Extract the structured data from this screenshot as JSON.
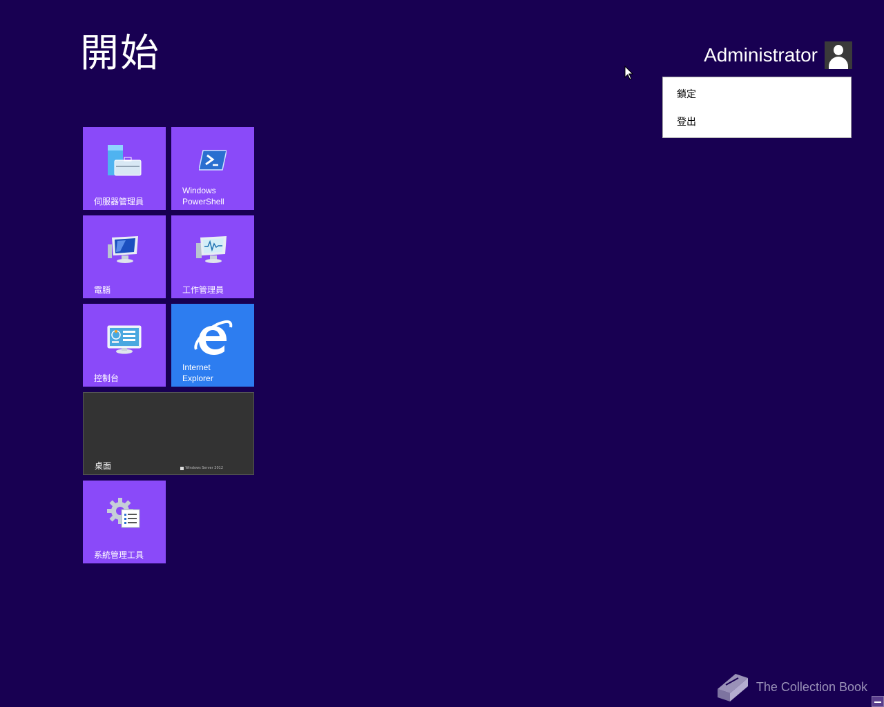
{
  "start": {
    "title": "開始"
  },
  "user": {
    "name": "Administrator",
    "menu": [
      {
        "label": "鎖定"
      },
      {
        "label": "登出"
      }
    ]
  },
  "tiles": {
    "server_manager": {
      "label": "伺服器管理員"
    },
    "powershell": {
      "label": "Windows\nPowerShell"
    },
    "computer": {
      "label": "電腦"
    },
    "task_manager": {
      "label": "工作管理員"
    },
    "control_panel": {
      "label": "控制台"
    },
    "internet_explorer": {
      "label": "Internet\nExplorer"
    },
    "desktop": {
      "label": "桌面",
      "brand": "Windows Server 2012"
    },
    "admin_tools": {
      "label": "系統管理工具"
    }
  },
  "watermark": {
    "text": "The Collection Book"
  },
  "colors": {
    "background": "#180052",
    "tile": "#8a4af9",
    "ie_tile": "#2d7df0",
    "desktop_tile": "#333333"
  }
}
